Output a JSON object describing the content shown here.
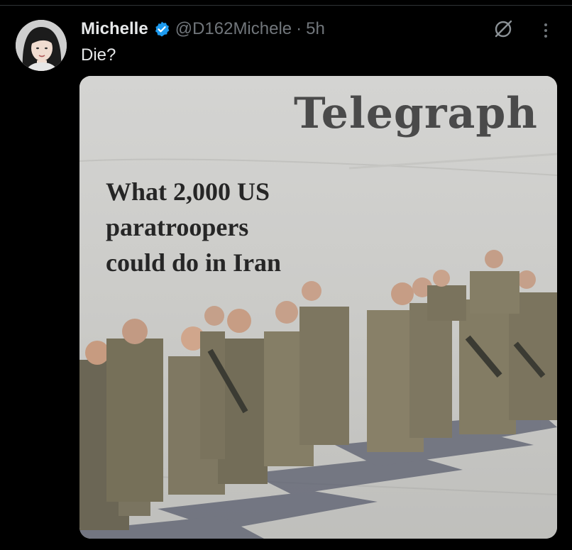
{
  "tweet": {
    "display_name": "Michelle",
    "handle": "@D162Michele",
    "separator": "·",
    "time": "5h",
    "text": "Die?"
  },
  "media": {
    "brand": "Telegraph",
    "headline_lines": [
      "What 2,000 US",
      "paratroopers",
      "could do in Iran"
    ]
  },
  "icons": {
    "verified": "verified-badge-icon",
    "grok": "grok-icon",
    "more": "more-options-icon"
  },
  "colors": {
    "background": "#000000",
    "text_primary": "#e7e9ea",
    "text_secondary": "#71767b",
    "verified_blue": "#1d9bf0"
  }
}
